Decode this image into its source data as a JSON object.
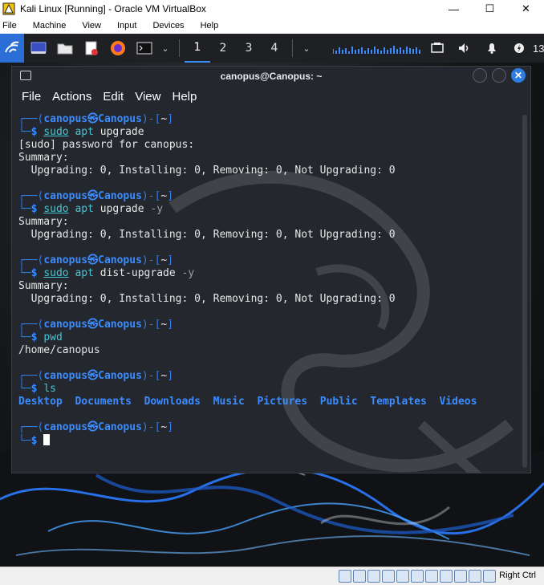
{
  "host": {
    "title": "Kali Linux [Running] - Oracle VM VirtualBox",
    "window_controls": [
      "—",
      "☐",
      "✕"
    ],
    "menu": [
      "File",
      "Machine",
      "View",
      "Input",
      "Devices",
      "Help"
    ]
  },
  "panel": {
    "workspaces": [
      "1",
      "2",
      "3",
      "4"
    ],
    "active_workspace": "1",
    "clock": "13"
  },
  "terminal": {
    "title": "canopus@Canopus: ~",
    "menu": [
      "File",
      "Actions",
      "Edit",
      "View",
      "Help"
    ],
    "user": "canopus",
    "host": "Canopus",
    "dir": "~",
    "commands": {
      "c1": [
        "sudo",
        "apt",
        "upgrade"
      ],
      "c2": [
        "sudo",
        "apt",
        "upgrade",
        "-y"
      ],
      "c3": [
        "sudo",
        "apt",
        "dist-upgrade",
        "-y"
      ],
      "c4": "pwd",
      "c5": "ls"
    },
    "output": {
      "password": "[sudo] password for canopus:",
      "summary": "Summary:",
      "upgrade_line": "  Upgrading: 0, Installing: 0, Removing: 0, Not Upgrading: 0",
      "pwd": "/home/canopus"
    },
    "ls_items": [
      "Desktop",
      "Documents",
      "Downloads",
      "Music",
      "Pictures",
      "Public",
      "Templates",
      "Videos"
    ]
  },
  "statusbar": {
    "host_key": "Right Ctrl"
  },
  "colors": {
    "accent": "#2f7de1",
    "prompt_user": "#3b8cff",
    "command": "#48c6d4",
    "terminal_bg": "#24272e"
  }
}
